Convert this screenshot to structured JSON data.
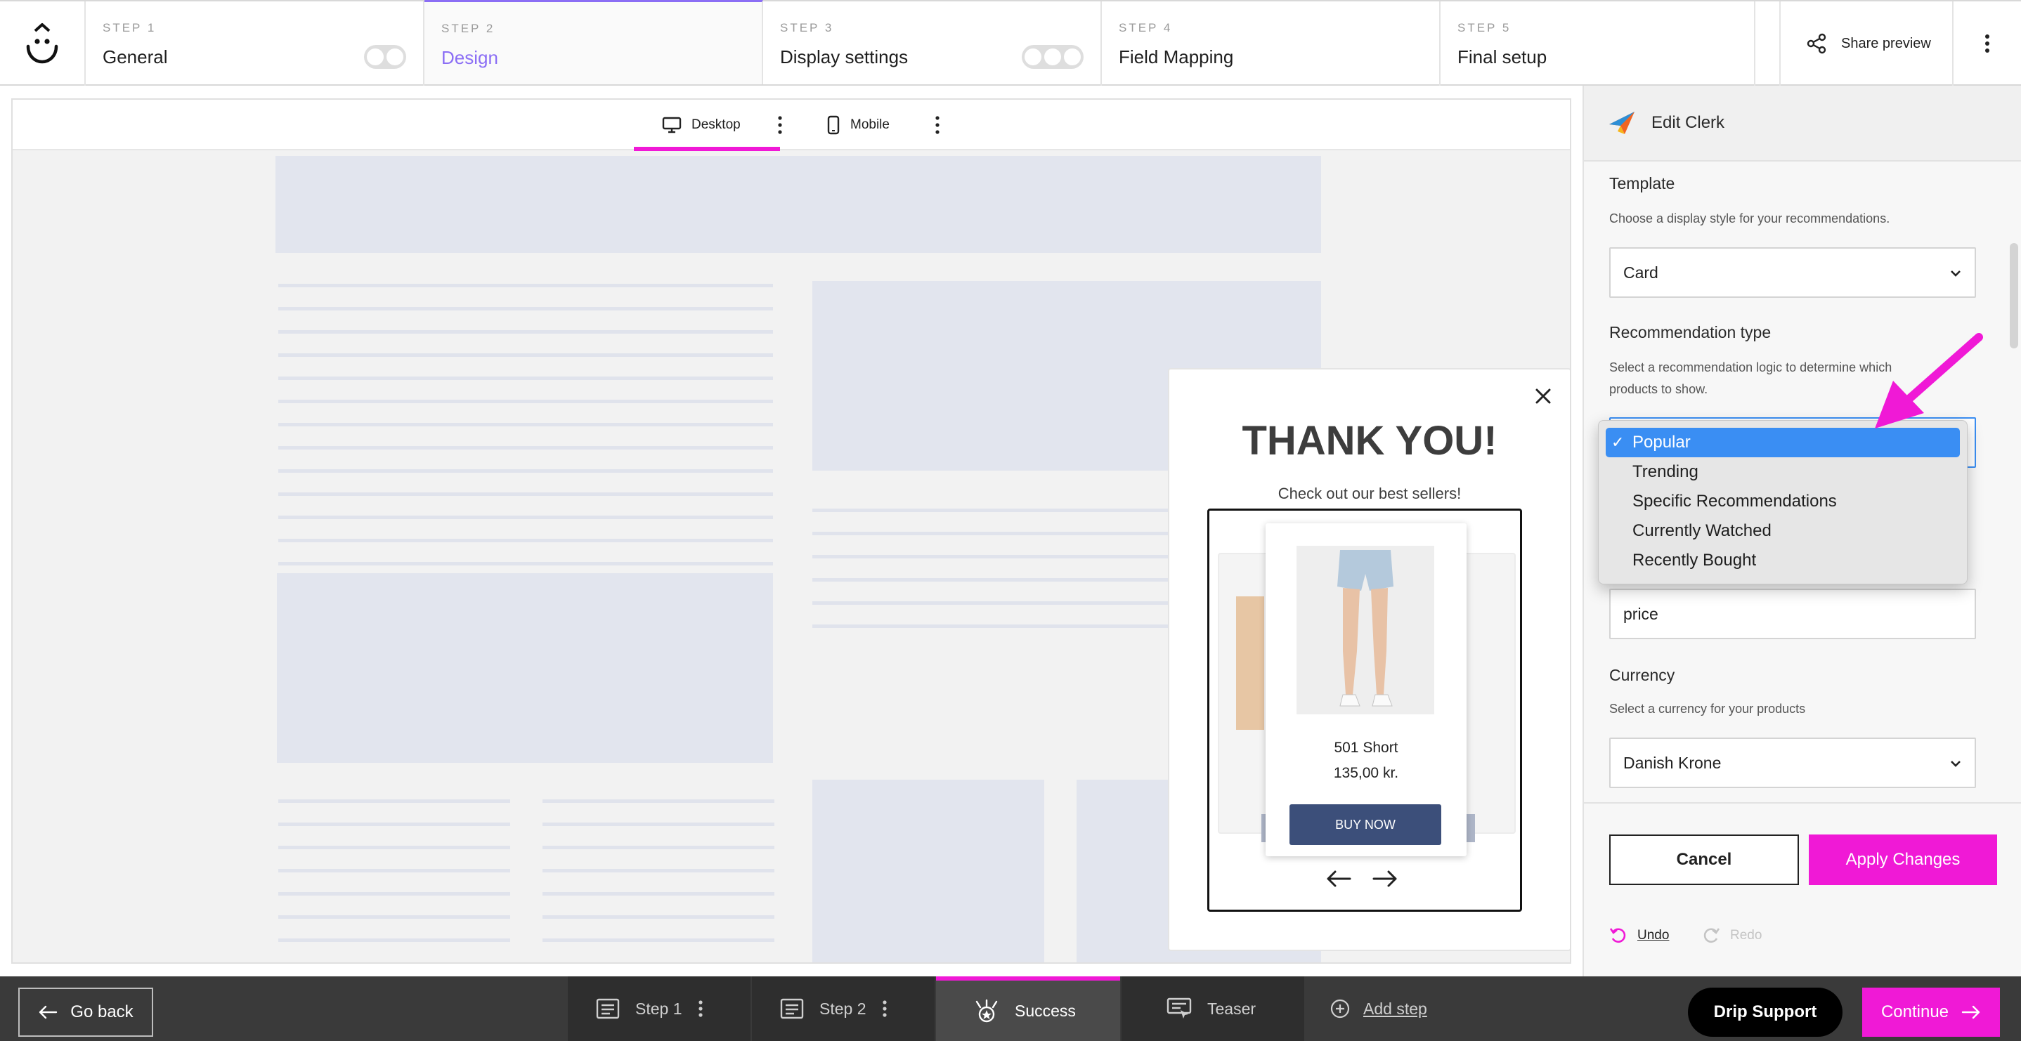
{
  "steps": [
    {
      "label": "STEP 1",
      "name": "General"
    },
    {
      "label": "STEP 2",
      "name": "Design"
    },
    {
      "label": "STEP 3",
      "name": "Display settings"
    },
    {
      "label": "STEP 4",
      "name": "Field Mapping"
    },
    {
      "label": "STEP 5",
      "name": "Final setup"
    }
  ],
  "header": {
    "share_label": "Share preview"
  },
  "canvas": {
    "desktop_label": "Desktop",
    "mobile_label": "Mobile"
  },
  "popup": {
    "title": "THANK YOU!",
    "subtitle": "Check out our best sellers!",
    "product_name": "501 Short",
    "product_price": "135,00 kr.",
    "buy_label": "BUY NOW"
  },
  "panel": {
    "title": "Edit Clerk",
    "template_label": "Template",
    "template_help": "Choose a display style for your recommendations.",
    "template_value": "Card",
    "rec_type_label": "Recommendation type",
    "rec_type_help": "Select a recommendation logic to determine which products to show.",
    "rec_options": [
      "Popular",
      "Trending",
      "Specific Recommendations",
      "Currently Watched",
      "Recently Bought"
    ],
    "rec_selected": "Popular",
    "price_field_value": "price",
    "currency_label": "Currency",
    "currency_help": "Select a currency for your products",
    "currency_value": "Danish Krone",
    "cancel_label": "Cancel",
    "apply_label": "Apply Changes",
    "undo_label": "Undo",
    "redo_label": "Redo"
  },
  "bottom": {
    "go_back": "Go back",
    "tabs": [
      "Step 1",
      "Step 2",
      "Success",
      "Teaser"
    ],
    "add_step": "Add step",
    "drip_support": "Drip Support",
    "continue": "Continue"
  },
  "colors": {
    "accent": "#f019d6",
    "step_active": "#8b6ef5",
    "buy_button": "#3c4f7a",
    "dropdown_selected": "#3a8ef3"
  }
}
